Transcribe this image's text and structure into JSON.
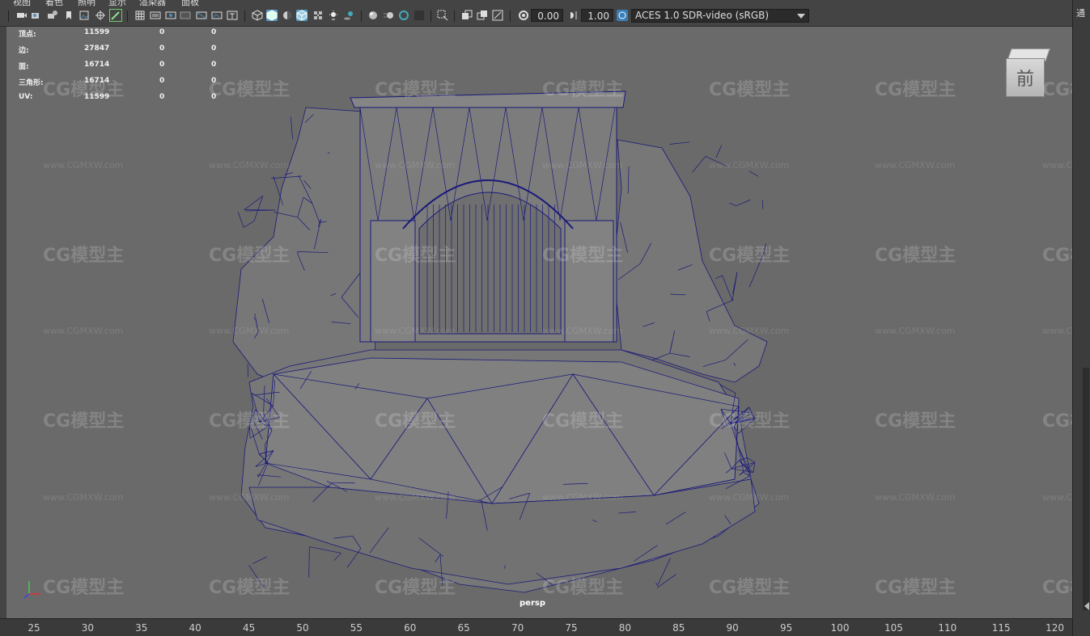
{
  "menu": {
    "items": [
      "视图",
      "着色",
      "照明",
      "显示",
      "渲染器",
      "面板"
    ]
  },
  "toolbar": {
    "exposure_value": "0.00",
    "gamma_value": "1.00",
    "color_management_label": "ACES 1.0 SDR-video (sRGB)"
  },
  "hud": {
    "rows": [
      {
        "label": "顶点:",
        "values": [
          "11599",
          "0",
          "0"
        ]
      },
      {
        "label": "边:",
        "values": [
          "27847",
          "0",
          "0"
        ]
      },
      {
        "label": "面:",
        "values": [
          "16714",
          "0",
          "0"
        ]
      },
      {
        "label": "三角形:",
        "values": [
          "16714",
          "0",
          "0"
        ]
      },
      {
        "label": "UV:",
        "values": [
          "11599",
          "0",
          "0"
        ]
      }
    ]
  },
  "view_cube": {
    "label": "前"
  },
  "viewport": {
    "camera_label": "persp"
  },
  "watermark": {
    "logo_text": "CG模型主",
    "url_text": "www.CGMXW.com"
  },
  "timeline": {
    "ticks": [
      "25",
      "30",
      "35",
      "40",
      "45",
      "50",
      "55",
      "60",
      "65",
      "70",
      "75",
      "80",
      "85",
      "90",
      "95",
      "100",
      "105",
      "110",
      "115",
      "120"
    ]
  },
  "right_panel": {
    "glyph": "通"
  },
  "colors": {
    "viewport_bg": "#6a6a6a",
    "wireframe": "#1a1a7a",
    "mesh_fill": "#7a7a7a",
    "active_icon": "#5aa0c8"
  }
}
